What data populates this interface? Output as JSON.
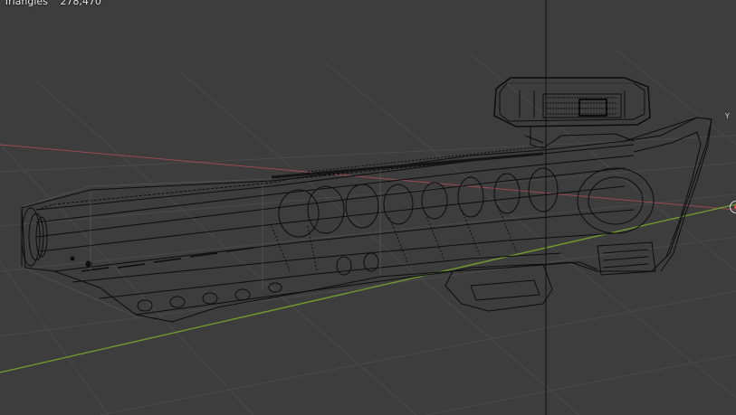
{
  "viewport": {
    "stats": {
      "label": "Triangles",
      "value": "278,470"
    },
    "axis_tick": "Y",
    "view_mode": "wireframe",
    "icons": {
      "transform_gizmo": "transform-gizmo-icon"
    },
    "colors": {
      "background": "#3d3d3d",
      "grid": "#4a4a4a",
      "x_axis": "#9b4a52",
      "y_axis": "#6f9a2f",
      "z_axis": "#1c1c1c",
      "wire": "#0d0d0d",
      "wire_light": "#6a6a6a"
    }
  }
}
